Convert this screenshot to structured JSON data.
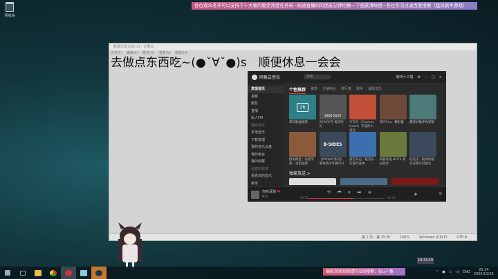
{
  "desktop": {
    "recycle_bin": "回收站"
  },
  "top_banner": "各位观众老爷可以支持下十大會的稳定热度任务呀~刚进直播间的朋友记得切换一下画質清晰度~各位实况过滤百度搜索（猛风疯牛游戏）",
  "notepad": {
    "title": "新建文本文档.txt - 记事本",
    "menu": [
      "文件(F)",
      "编辑(E)",
      "格式(O)",
      "查看(V)",
      "帮助(H)"
    ],
    "content": "去做点东西吃~(●ˇ∀ˇ●)s　顺便休息一会会",
    "status": {
      "position": "第 1 行，第 25 列",
      "zoom": "100%",
      "eol": "Windows (CRLF)",
      "encoding": "UTF-8"
    }
  },
  "music": {
    "app_name": "网易云音乐",
    "search_placeholder": "搜索",
    "user": "咖啡十三喵",
    "sidebar": [
      "发现音乐",
      "视频",
      "朋友",
      "直播",
      "私人FM",
      "我的音乐",
      "本地音乐",
      "下载管理",
      "我的音乐云盘",
      "我的电台",
      "我的收藏",
      "创建的歌单",
      "我喜欢的音乐",
      "歌单"
    ],
    "tabs": [
      "个性推荐",
      "歌单",
      "主播电台",
      "排行榜",
      "歌手",
      "最新音乐"
    ],
    "row1": [
      {
        "label": "每日歌曲推荐",
        "color": "#2f7f88"
      },
      {
        "label": "2020岁月 再见时光",
        "color": "#555"
      },
      {
        "label": "今天の（Cosmos Heart）平成的人演出",
        "color": "#c25038"
      },
      {
        "label": "流行Cos、精彩集",
        "color": "#6d4a3a"
      },
      {
        "label": "最新好歌伴你安眠",
        "color": "#4b7a78"
      }
    ],
    "row2": [
      {
        "label": "欧美精选：伤感节奏，治愈旋律",
        "color": "#8a5a3a"
      },
      {
        "label": "【PAYDAY系列】游戏原声专辑OST",
        "color": "#3a4a5a"
      },
      {
        "label": "旅行日记：轻音乐在旅行途中",
        "color": "#3b6fb0"
      },
      {
        "label": "风暴英雄 HOTS 高分歌单",
        "color": "#6a7a3a"
      },
      {
        "label": "轻电子｜期待你能为日落写封歌信",
        "color": "#3a4a5a"
      }
    ],
    "calendar_day": "26",
    "cover_text": [
      "1960-2020",
      "B-SIDES"
    ],
    "section": "独家放送 >",
    "player": {
      "song": "你的深渊",
      "artist": "RIO",
      "time_current": "00:50",
      "time_total": "03:35"
    }
  },
  "timestamp_tip": "20:33:59",
  "bottom_banner": "幽影游戏视频请在B站搜索：Biu十香",
  "tray": {
    "lang": "ENG",
    "time": "20:34",
    "date": "2020/11/26"
  }
}
